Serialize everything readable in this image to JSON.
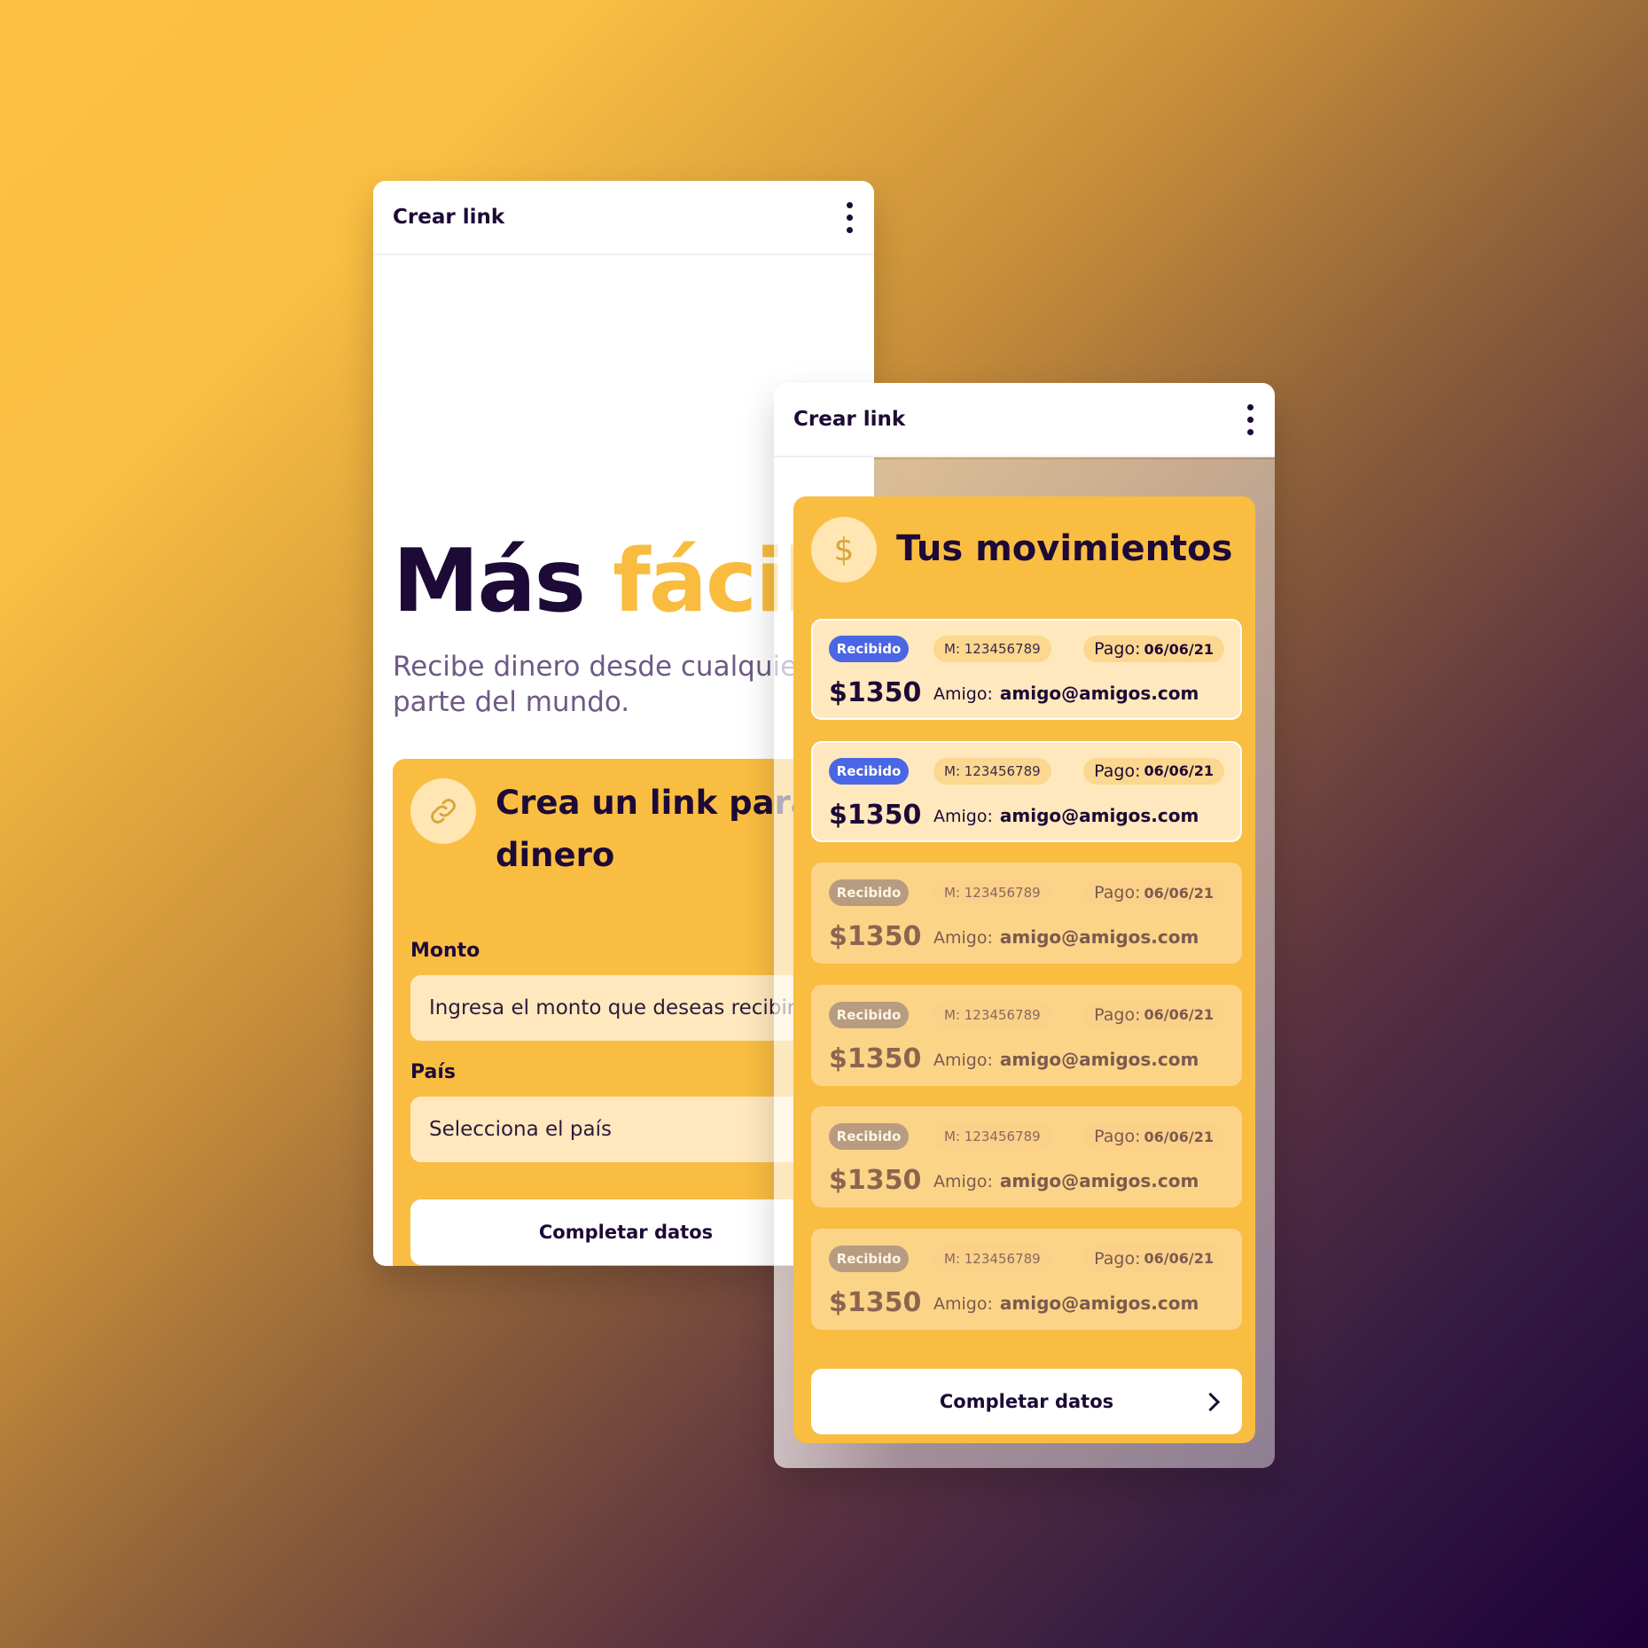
{
  "phone_a": {
    "appbar": {
      "title": "Crear link"
    },
    "hero": {
      "title_part1": "Más",
      "title_part2": "fácil",
      "subtitle": "Recibe dinero desde cualquier parte del mundo."
    },
    "card": {
      "title": "Crea un link para recibir dinero",
      "monto_label": "Monto",
      "monto_placeholder": "Ingresa el monto que deseas recibir",
      "pais_label": "País",
      "pais_placeholder": "Selecciona el país",
      "button": "Completar datos"
    }
  },
  "phone_b": {
    "appbar": {
      "title": "Crear link"
    },
    "card": {
      "title": "Tus movimientos",
      "icon": "$",
      "button": "Completar datos"
    },
    "movements": [
      {
        "status": "Recibido",
        "ref": "M: 123456789",
        "pago_label": "Pago:",
        "pago_date": "06/06/21",
        "amount": "$1350",
        "amigo_label": "Amigo:",
        "amigo_email": "amigo@amigos.com"
      },
      {
        "status": "Recibido",
        "ref": "M: 123456789",
        "pago_label": "Pago:",
        "pago_date": "06/06/21",
        "amount": "$1350",
        "amigo_label": "Amigo:",
        "amigo_email": "amigo@amigos.com"
      },
      {
        "status": "Recibido",
        "ref": "M: 123456789",
        "pago_label": "Pago:",
        "pago_date": "06/06/21",
        "amount": "$1350",
        "amigo_label": "Amigo:",
        "amigo_email": "amigo@amigos.com"
      },
      {
        "status": "Recibido",
        "ref": "M: 123456789",
        "pago_label": "Pago:",
        "pago_date": "06/06/21",
        "amount": "$1350",
        "amigo_label": "Amigo:",
        "amigo_email": "amigo@amigos.com"
      },
      {
        "status": "Recibido",
        "ref": "M: 123456789",
        "pago_label": "Pago:",
        "pago_date": "06/06/21",
        "amount": "$1350",
        "amigo_label": "Amigo:",
        "amigo_email": "amigo@amigos.com"
      },
      {
        "status": "Recibido",
        "ref": "M: 123456789",
        "pago_label": "Pago:",
        "pago_date": "06/06/21",
        "amount": "$1350",
        "amigo_label": "Amigo:",
        "amigo_email": "amigo@amigos.com"
      }
    ]
  },
  "colors": {
    "accent": "#f9bd42",
    "dark": "#1d0a36",
    "badge_blue": "#4a66e4"
  }
}
